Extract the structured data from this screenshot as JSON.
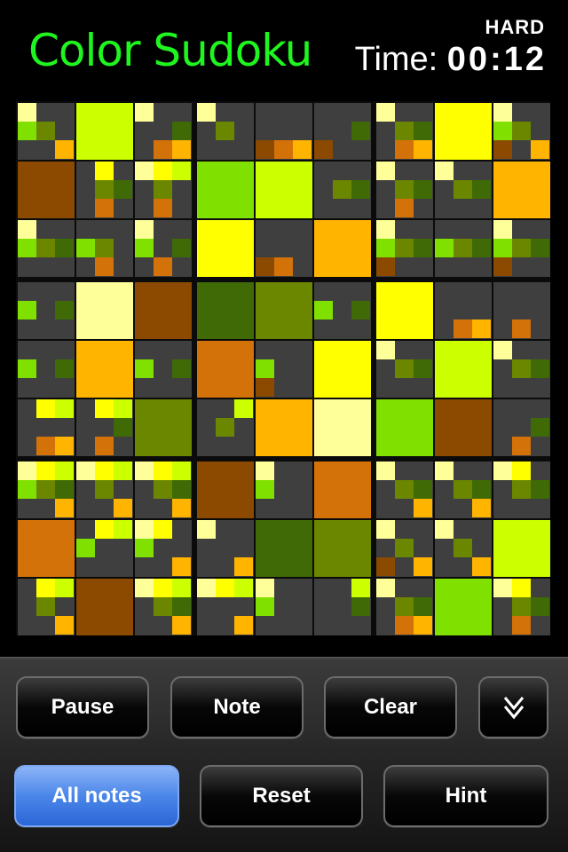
{
  "app": {
    "title": "Color Sudoku",
    "difficulty": "HARD",
    "timer_label": "Time:",
    "timer_value": "00:12"
  },
  "colors": {
    "title_green": "#1ff51f",
    "cell_bg": "#3f3f3f",
    "palette": {
      "1": "#ffff99",
      "2": "#ffff00",
      "3": "#ccff00",
      "4": "#80e000",
      "5": "#6b8700",
      "6": "#3f6a06",
      "7": "#8b4a00",
      "8": "#d4720a",
      "9": "#ffb400"
    }
  },
  "board": {
    "given": [
      [
        0,
        3,
        0,
        0,
        0,
        0,
        0,
        2,
        0
      ],
      [
        7,
        0,
        0,
        4,
        3,
        0,
        0,
        0,
        9
      ],
      [
        0,
        0,
        0,
        2,
        0,
        9,
        0,
        0,
        0
      ],
      [
        0,
        1,
        7,
        6,
        5,
        0,
        2,
        0,
        0
      ],
      [
        0,
        9,
        0,
        8,
        0,
        2,
        0,
        3,
        0
      ],
      [
        0,
        0,
        5,
        0,
        9,
        1,
        4,
        7,
        0
      ],
      [
        0,
        0,
        0,
        7,
        0,
        8,
        0,
        0,
        0
      ],
      [
        8,
        0,
        0,
        0,
        6,
        5,
        0,
        0,
        3
      ],
      [
        0,
        7,
        0,
        0,
        0,
        0,
        0,
        4,
        0
      ]
    ],
    "notes": [
      [
        [
          1,
          4,
          5,
          9
        ],
        [],
        [
          1,
          6,
          8,
          9
        ],
        [
          1,
          5
        ],
        [
          7,
          8,
          9
        ],
        [
          7,
          6
        ],
        [
          1,
          5,
          6,
          8,
          9
        ],
        [],
        [
          1,
          4,
          5,
          7,
          9
        ]
      ],
      [
        [],
        [
          2,
          5,
          6,
          8
        ],
        [
          1,
          2,
          3,
          5,
          8
        ],
        [],
        [],
        [
          5,
          6
        ],
        [
          1,
          5,
          6,
          8
        ],
        [
          1,
          5,
          6
        ],
        []
      ],
      [
        [
          1,
          4,
          5,
          6
        ],
        [
          4,
          5,
          8
        ],
        [
          1,
          4,
          6,
          8
        ],
        [],
        [
          7,
          8
        ],
        [],
        [
          1,
          4,
          5,
          6,
          7
        ],
        [
          4,
          5,
          6
        ],
        [
          1,
          4,
          5,
          6,
          7
        ]
      ],
      [
        [
          4,
          6
        ],
        [],
        [],
        [],
        [],
        [
          4,
          6
        ],
        [],
        [
          8,
          9
        ],
        [
          8
        ]
      ],
      [
        [
          4,
          6
        ],
        [],
        [
          4,
          6
        ],
        [],
        [
          4,
          7
        ],
        [],
        [
          1,
          5,
          6
        ],
        [],
        [
          1,
          5,
          6
        ]
      ],
      [
        [
          2,
          3,
          8,
          9
        ],
        [
          2,
          3,
          6,
          8
        ],
        [],
        [
          3,
          5
        ],
        [],
        [],
        [],
        [],
        [
          6,
          8
        ]
      ],
      [
        [
          1,
          2,
          3,
          4,
          5,
          6,
          9
        ],
        [
          1,
          2,
          3,
          5,
          9
        ],
        [
          1,
          2,
          3,
          5,
          6,
          9
        ],
        [],
        [
          1,
          4
        ],
        [],
        [
          1,
          5,
          6,
          9
        ],
        [
          1,
          5,
          6,
          9
        ],
        [
          1,
          2,
          5,
          6
        ]
      ],
      [
        [],
        [
          2,
          3,
          4
        ],
        [
          1,
          2,
          4,
          9
        ],
        [
          1,
          9
        ],
        [],
        [],
        [
          1,
          5,
          7,
          9
        ],
        [
          1,
          5,
          9
        ],
        []
      ],
      [
        [
          2,
          3,
          5,
          9
        ],
        [],
        [
          1,
          2,
          3,
          5,
          6,
          9
        ],
        [
          1,
          2,
          3,
          9
        ],
        [
          1,
          4
        ],
        [
          3,
          6
        ],
        [
          1,
          5,
          6,
          8,
          9
        ],
        [],
        [
          1,
          2,
          5,
          6,
          8
        ]
      ]
    ]
  },
  "controls": {
    "pause": "Pause",
    "note": "Note",
    "clear": "Clear",
    "all_notes": "All notes",
    "reset": "Reset",
    "hint": "Hint",
    "all_notes_active": true
  },
  "icons": {
    "expand": "double-chevron-down-icon"
  }
}
